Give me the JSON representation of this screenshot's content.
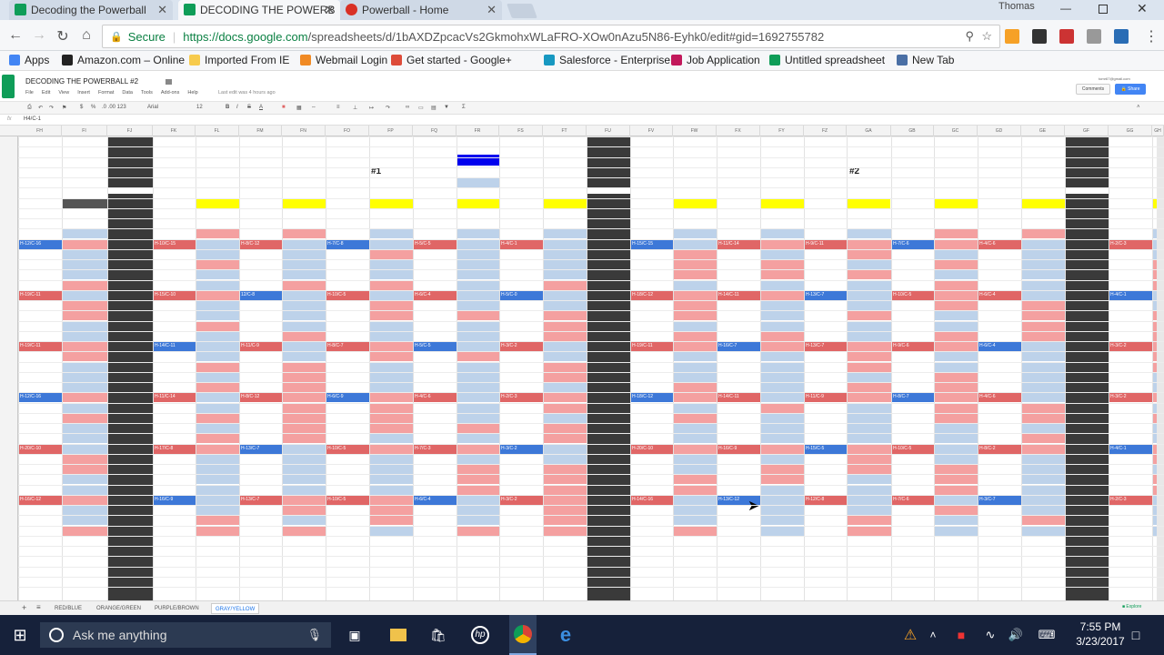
{
  "browser": {
    "tabs": [
      {
        "title": "Decoding the Powerball",
        "color": "#0f9d58",
        "active": false
      },
      {
        "title": "DECODING THE POWERB",
        "color": "#0f9d58",
        "active": true
      },
      {
        "title": "Powerball - Home",
        "color": "#d93025",
        "active": false
      }
    ],
    "user": "Thomas",
    "url_secure": "Secure",
    "url_host": "https://docs.google.com",
    "url_path": "/spreadsheets/d/1bAXDZpcacVs2GkmohxWLaFRO-XOw0nAzu5N86-Eyhk0/edit#gid=1692755782",
    "bookmarks": [
      {
        "label": "Apps",
        "color": "#4285f4"
      },
      {
        "label": "Amazon.com – Online",
        "color": "#222222"
      },
      {
        "label": "Imported From IE",
        "color": "#f7cb4d"
      },
      {
        "label": "Webmail Login",
        "color": "#f08a24"
      },
      {
        "label": "Get started - Google+",
        "color": "#dd4b39"
      },
      {
        "label": "Salesforce - Enterprise",
        "color": "#1798c1"
      },
      {
        "label": "Job Application",
        "color": "#c2185b"
      },
      {
        "label": "Untitled spreadsheet",
        "color": "#0f9d58"
      },
      {
        "label": "New Tab",
        "color": "#4a6fa5"
      }
    ]
  },
  "sheets": {
    "title": "DECODING THE POWERBALL #2",
    "menu": [
      "File",
      "Edit",
      "View",
      "Insert",
      "Format",
      "Data",
      "Tools",
      "Add-ons",
      "Help"
    ],
    "last_edit": "Last edit was 4 hours ago",
    "account": "tomr67@gmail.com",
    "comments_label": "Comments",
    "share_label": "Share",
    "font": "Arial",
    "font_size": "12",
    "cell_ref": "H4/C-1",
    "section1": "#1",
    "section2": "#2",
    "sheet_tabs": [
      "RED/BLUE",
      "ORANGE/GREEN",
      "PURPLE/BROWN",
      "GRAY/YELLOW"
    ],
    "active_sheet": "GRAY/YELLOW",
    "explore_label": "Explore",
    "col_headers": [
      "FH",
      "FI",
      "FJ",
      "FK",
      "FL",
      "FM",
      "FN",
      "FO",
      "FP",
      "FQ",
      "FR",
      "FS",
      "FT",
      "FU",
      "FV",
      "FW",
      "FX",
      "FY",
      "FZ",
      "GA",
      "GB",
      "GC",
      "GD",
      "GE",
      "GF",
      "GG",
      "GH"
    ],
    "labels1": [
      "H-12/C-16",
      "H-19/C-11",
      "H-19/C-11",
      "H-12/C-16",
      "H-20/C-10",
      "H-16/C-12",
      "H-10/C-15",
      "H-15/C-10",
      "H-14/C-11",
      "H-11/C-14",
      "H-17/C-8",
      "H-16/C-9",
      "H-8/C-12",
      "12/C-8",
      "H-11/C-9",
      "H-8/C-12",
      "H-13/C-7",
      "H-13/C-7",
      "H-7/C-8",
      "H-10/C-5",
      "H-8/C-7",
      "H-6/C-9",
      "H-10/C-5",
      "H-10/C-5",
      "H-5/C-5",
      "H-6/C-4",
      "H-5/C-5",
      "H-4/C-6",
      "H-7/C-3",
      "H-6/C-4",
      "H-4/C-1",
      "H-5/C-0",
      "H-3/C-2",
      "H-2/C-3",
      "H-3/C-2",
      "H-3/C-2"
    ],
    "labels2": [
      "H-15/C-15",
      "H-18/C-12",
      "H-19/C-11",
      "H-18/C-12",
      "H-20/C-10",
      "H-14/C-16",
      "H-11/C-14",
      "H-14/C-11",
      "H-16/C-7",
      "H-14/C-11",
      "H-16/C-9",
      "H-13/C-12",
      "H-9/C-11",
      "H-13/C-7",
      "H-13/C-7",
      "H-11/C-9",
      "H-15/C-5",
      "H-12/C-8",
      "H-7/C-6",
      "H-10/C-5",
      "H-9/C-6",
      "H-8/C-7",
      "H-10/C-5",
      "H-7/C-6",
      "H-4/C-6",
      "H-6/C-4",
      "H-6/C-4",
      "H-4/C-6",
      "H-8/C-2",
      "H-3/C-7",
      "H-2/C-3",
      "H-4/C-1",
      "H-3/C-2",
      "H-3/C-2",
      "H-4/C-1",
      "H-2/C-3"
    ]
  },
  "taskbar": {
    "search_placeholder": "Ask me anything",
    "time": "7:55 PM",
    "date": "3/23/2017"
  }
}
